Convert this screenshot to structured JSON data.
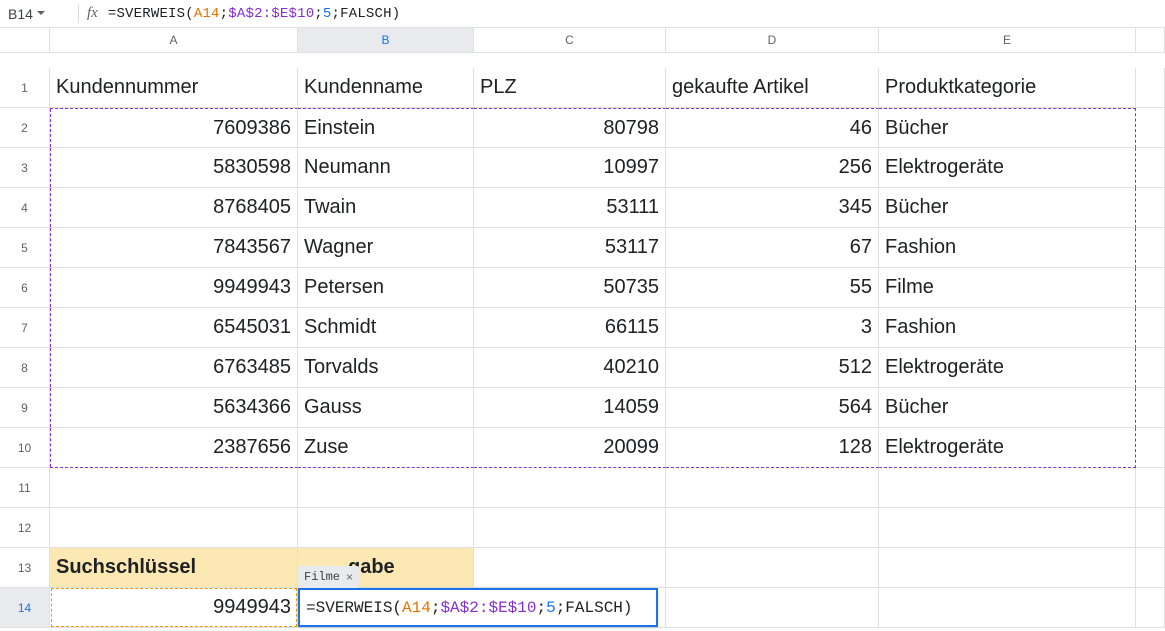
{
  "namebox": "B14",
  "formula": {
    "raw": "=SVERWEIS(A14;$A$2:$E$10;5;FALSCH)",
    "func": "SVERWEIS",
    "arg1": "A14",
    "arg2": "$A$2:$E$10",
    "arg3": "5",
    "arg4": "FALSCH"
  },
  "columns": [
    "A",
    "B",
    "C",
    "D",
    "E"
  ],
  "rows": [
    "1",
    "2",
    "3",
    "4",
    "5",
    "6",
    "7",
    "8",
    "9",
    "10",
    "11",
    "12",
    "13",
    "14"
  ],
  "headers": {
    "A": "Kundennummer",
    "B": "Kundenname",
    "C": "PLZ",
    "D": "gekaufte Artikel",
    "E": "Produktkategorie"
  },
  "data": [
    {
      "A": "7609386",
      "B": "Einstein",
      "C": "80798",
      "D": "46",
      "E": "Bücher"
    },
    {
      "A": "5830598",
      "B": "Neumann",
      "C": "10997",
      "D": "256",
      "E": "Elektrogeräte"
    },
    {
      "A": "8768405",
      "B": "Twain",
      "C": "53111",
      "D": "345",
      "E": "Bücher"
    },
    {
      "A": "7843567",
      "B": "Wagner",
      "C": "53117",
      "D": "67",
      "E": "Fashion"
    },
    {
      "A": "9949943",
      "B": "Petersen",
      "C": "50735",
      "D": "55",
      "E": "Filme"
    },
    {
      "A": "6545031",
      "B": "Schmidt",
      "C": "66115",
      "D": "3",
      "E": "Fashion"
    },
    {
      "A": "6763485",
      "B": "Torvalds",
      "C": "40210",
      "D": "512",
      "E": "Elektrogeräte"
    },
    {
      "A": "5634366",
      "B": "Gauss",
      "C": "14059",
      "D": "564",
      "E": "Bücher"
    },
    {
      "A": "2387656",
      "B": "Zuse",
      "C": "20099",
      "D": "128",
      "E": "Elektrogeräte"
    }
  ],
  "row13": {
    "A": "Suchschlüssel",
    "B_fragment": "gabe"
  },
  "row14": {
    "A": "9949943"
  },
  "result_chip": "Filme",
  "chart_data": {
    "type": "table",
    "columns": [
      "Kundennummer",
      "Kundenname",
      "PLZ",
      "gekaufte Artikel",
      "Produktkategorie"
    ],
    "rows": [
      [
        7609386,
        "Einstein",
        80798,
        46,
        "Bücher"
      ],
      [
        5830598,
        "Neumann",
        10997,
        256,
        "Elektrogeräte"
      ],
      [
        8768405,
        "Twain",
        53111,
        345,
        "Bücher"
      ],
      [
        7843567,
        "Wagner",
        53117,
        67,
        "Fashion"
      ],
      [
        9949943,
        "Petersen",
        50735,
        55,
        "Filme"
      ],
      [
        6545031,
        "Schmidt",
        66115,
        3,
        "Fashion"
      ],
      [
        6763485,
        "Torvalds",
        40210,
        512,
        "Elektrogeräte"
      ],
      [
        5634366,
        "Gauss",
        14059,
        564,
        "Bücher"
      ],
      [
        2387656,
        "Zuse",
        20099,
        128,
        "Elektrogeräte"
      ]
    ],
    "lookup": {
      "function": "SVERWEIS",
      "search_key_cell": "A14",
      "search_key_value": 9949943,
      "range": "$A$2:$E$10",
      "index": 5,
      "is_sorted": false,
      "result": "Filme"
    }
  }
}
